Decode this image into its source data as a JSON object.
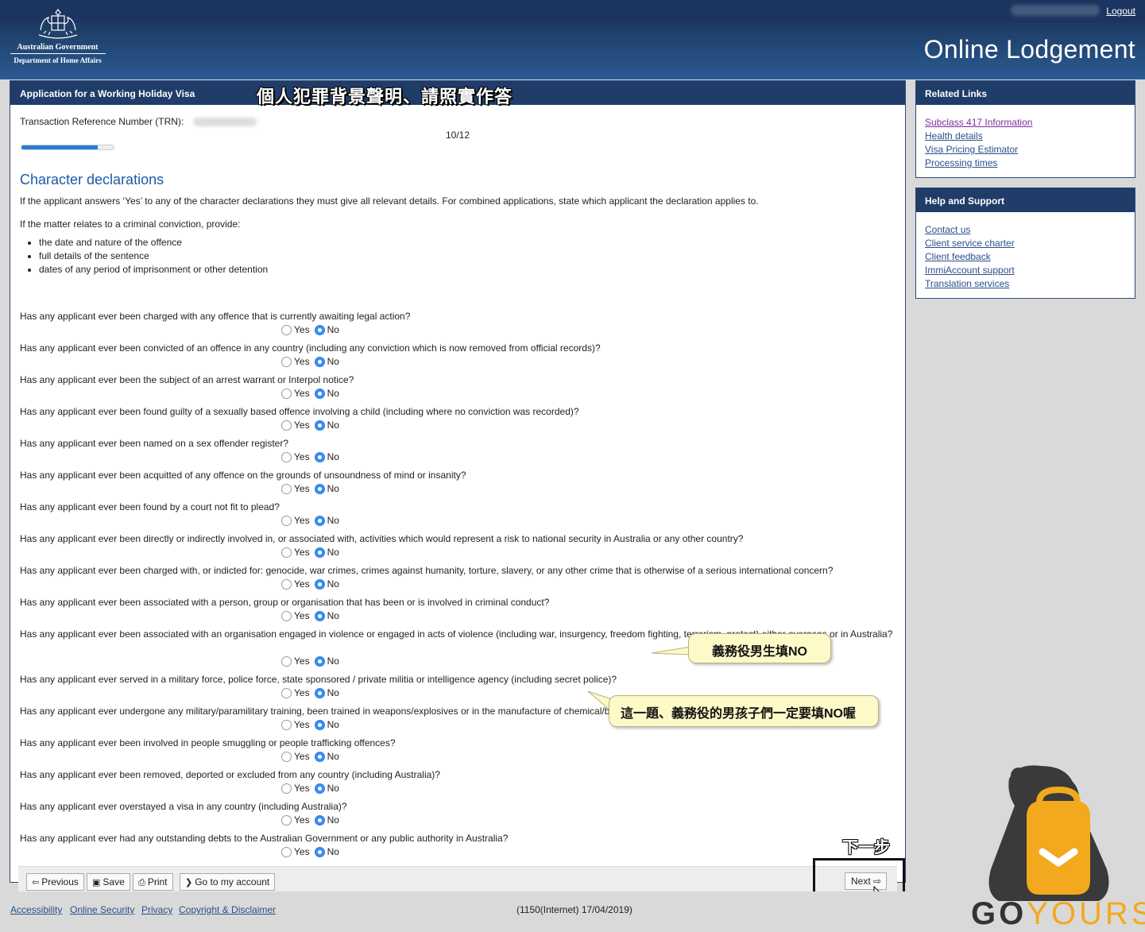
{
  "header": {
    "logo_line1": "Australian Government",
    "logo_line2": "Department of Home Affairs",
    "logout": "Logout",
    "site_title": "Online Lodgement"
  },
  "main": {
    "panel_title": "Application for a Working Holiday Visa",
    "overlay_title": "個人犯罪背景聲明、請照實作答",
    "trn_label": "Transaction Reference Number (TRN):",
    "progress_label": "10/12",
    "progress_fraction": 0.83,
    "section_title": "Character declarations",
    "intro": "If the applicant answers ‘Yes’ to any of the character declarations they must give all relevant details. For combined applications, state which applicant the declaration applies to.",
    "intro2": "If the matter relates to a criminal conviction, provide:",
    "bullets": [
      "the date and nature of the offence",
      "full details of the sentence",
      "dates of any period of imprisonment or other detention"
    ],
    "yes_label": "Yes",
    "no_label": "No",
    "questions": [
      "Has any applicant ever been charged with any offence that is currently awaiting legal action?",
      "Has any applicant ever been convicted of an offence in any country (including any conviction which is now removed from official records)?",
      "Has any applicant ever been the subject of an arrest warrant or Interpol notice?",
      "Has any applicant ever been found guilty of a sexually based offence involving a child (including where no conviction was recorded)?",
      "Has any applicant ever been named on a sex offender register?",
      "Has any applicant ever been acquitted of any offence on the grounds of unsoundness of mind or insanity?",
      "Has any applicant ever been found by a court not fit to plead?",
      "Has any applicant ever been directly or indirectly involved in, or associated with, activities which would represent a risk to national security in Australia or any other country?",
      "Has any applicant ever been charged with, or indicted for: genocide, war crimes, crimes against humanity, torture, slavery, or any other crime that is otherwise of a serious international concern?",
      "Has any applicant ever been associated with a person, group or organisation that has been or is involved in criminal conduct?",
      "Has any applicant ever been associated with an organisation engaged in violence or engaged in acts of violence (including war, insurgency, freedom fighting, terrorism, protest) either overseas or in Australia?",
      "Has any applicant ever served in a military force, police force, state sponsored / private militia or intelligence agency (including secret police)?",
      "Has any applicant ever undergone any military/paramilitary training, been trained in weapons/explosives or in the manufacture of chemical/biological products?",
      "Has any applicant ever been involved in people smuggling or people trafficking offences?",
      "Has any applicant ever been removed, deported or excluded from any country (including Australia)?",
      "Has any applicant ever overstayed a visa in any country (including Australia)?",
      "Has any applicant ever had any outstanding debts to the Australian Government or any public authority in Australia?"
    ],
    "callout1": "義務役男生填NO",
    "callout2": "這一題、義務役的男孩子們一定要填NO喔",
    "nav": {
      "previous": "Previous",
      "save": "Save",
      "print": "Print",
      "account": "Go to my account",
      "next": "Next",
      "next_caption": "下一步"
    }
  },
  "sidebar": {
    "related_title": "Related Links",
    "related_links": [
      "Subclass 417 Information",
      "Health details",
      "Visa Pricing Estimator",
      "Processing times"
    ],
    "help_title": "Help and Support",
    "help_links": [
      "Contact us",
      "Client service charter",
      "Client feedback",
      "ImmiAccount support",
      "Translation services"
    ]
  },
  "footer": {
    "links": [
      "Accessibility",
      "Online Security",
      "Privacy",
      "Copyright & Disclaimer"
    ],
    "version": "(1150(Internet) 17/04/2019)"
  },
  "brand": {
    "go": "GO",
    "yours": "YOURS"
  }
}
